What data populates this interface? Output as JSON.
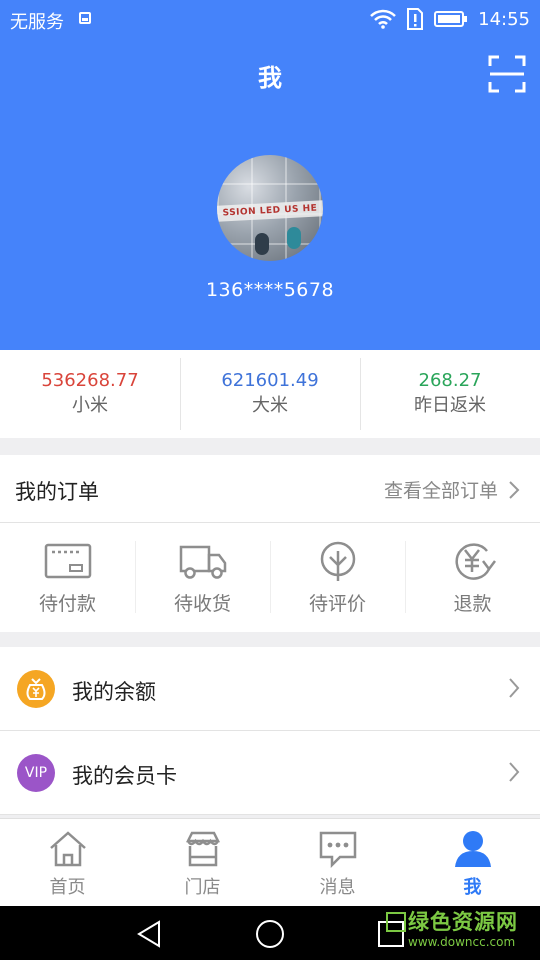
{
  "status_bar": {
    "carrier": "无服务",
    "time": "14:55"
  },
  "header": {
    "title": "我",
    "phone": "136****5678",
    "avatar_text": "SSION LED US HE"
  },
  "stats": [
    {
      "value": "536268.77",
      "label": "小米",
      "color": "#d9443a"
    },
    {
      "value": "621601.49",
      "label": "大米",
      "color": "#3f73d9"
    },
    {
      "value": "268.27",
      "label": "昨日返米",
      "color": "#2aa55a"
    }
  ],
  "orders": {
    "title": "我的订单",
    "view_all": "查看全部订单",
    "items": [
      {
        "label": "待付款",
        "icon": "card-icon"
      },
      {
        "label": "待收货",
        "icon": "truck-icon"
      },
      {
        "label": "待评价",
        "icon": "tree-icon"
      },
      {
        "label": "退款",
        "icon": "yen-refresh-icon"
      }
    ]
  },
  "menu": [
    {
      "label": "我的余额",
      "icon": "money-bag-icon",
      "icon_text": "¥",
      "color": "#f5a623"
    },
    {
      "label": "我的会员卡",
      "icon": "vip-icon",
      "icon_text": "VIP",
      "color": "#9b55c8"
    }
  ],
  "tabs": [
    {
      "label": "首页",
      "icon": "home-icon",
      "active": false
    },
    {
      "label": "门店",
      "icon": "store-icon",
      "active": false
    },
    {
      "label": "消息",
      "icon": "message-icon",
      "active": false
    },
    {
      "label": "我",
      "icon": "person-icon",
      "active": true
    }
  ],
  "colors": {
    "primary": "#4583fa",
    "tab_active": "#2f7af6"
  },
  "watermark": {
    "main": "绿色资源网",
    "sub": "www.downcc.com"
  }
}
